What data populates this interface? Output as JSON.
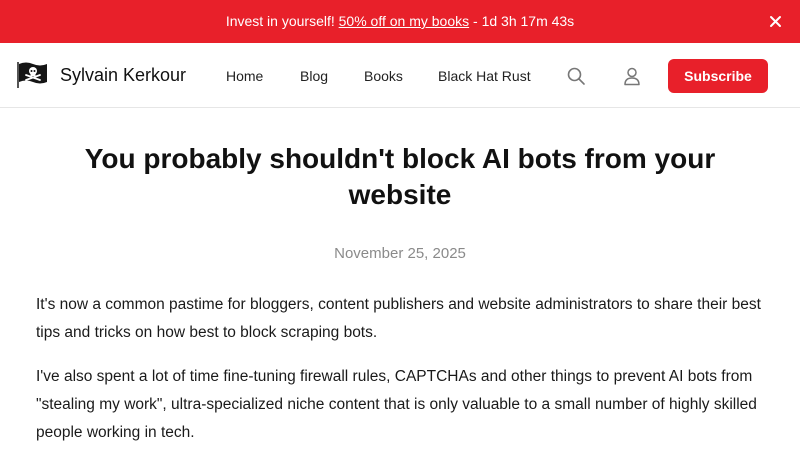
{
  "promo": {
    "lead": "Invest in yourself! ",
    "link": "50% off on my books",
    "countdown": " - 1d 3h 17m 43s"
  },
  "header": {
    "site_name": "Sylvain Kerkour",
    "nav": [
      "Home",
      "Blog",
      "Books",
      "Black Hat Rust"
    ],
    "subscribe_label": "Subscribe",
    "brand_color": "#e8202a"
  },
  "icons": [
    "close-icon",
    "pirate-flag-logo",
    "search-icon",
    "account-icon"
  ],
  "article": {
    "title": "You probably shouldn't block AI bots from your website",
    "date": "November 25, 2025",
    "paragraphs": [
      "It's now a common pastime for bloggers, content publishers and website administrators to share their best tips and tricks on how best to block scraping bots.",
      "I've also spent a lot of time fine-tuning firewall rules, CAPTCHAs and other things to prevent AI bots from \"stealing my work\", ultra-specialized niche content that is only valuable to a small number of highly skilled people working in tech."
    ]
  }
}
